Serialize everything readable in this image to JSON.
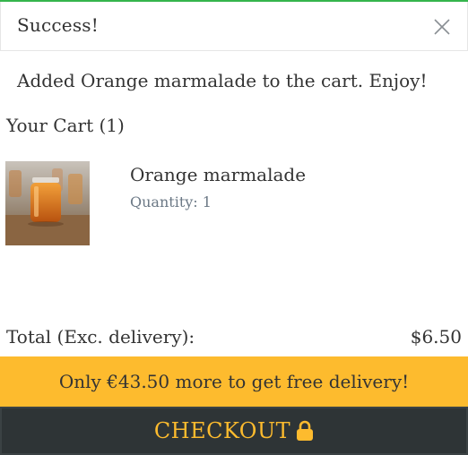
{
  "colors": {
    "success_accent": "#35b54c",
    "banner_bg": "#fdbb2e",
    "checkout_bg": "#2e3436",
    "checkout_text": "#fdbb2e"
  },
  "header": {
    "title": "Success!",
    "close_icon": "close-icon"
  },
  "message": "Added Orange marmalade to the cart. Enjoy!",
  "cart": {
    "heading": "Your Cart (1)",
    "items": [
      {
        "image_icon": "marmalade-jar-photo",
        "name": "Orange marmalade",
        "quantity_label": "Quantity: 1"
      }
    ]
  },
  "totals": {
    "label": "Total (Exc. delivery):",
    "value": "$6.50"
  },
  "delivery_banner": "Only €43.50 more to get free delivery!",
  "checkout": {
    "label": "CHECKOUT",
    "icon": "lock-icon"
  }
}
